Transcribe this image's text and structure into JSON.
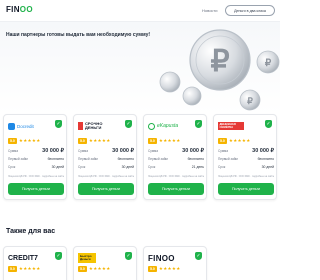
{
  "header": {
    "logo_main": "FIN",
    "logo_accent": "OO",
    "nav_news": "Новости",
    "cta_label": "Деньги в два клика"
  },
  "hero": {
    "title": "Наши партнеры готовы выдать вам необходимую сумму!"
  },
  "labels": {
    "amount": "Сумма",
    "first_loan": "Первый займ",
    "term": "Срок",
    "get_money": "Получить деньги",
    "fine_print": "Лицензия ЦБ РФ · ООО МКК · подробнее на сайте"
  },
  "offers": [
    {
      "name": "Docredit",
      "rating": "5.0",
      "amount": "30 000 ₽",
      "first_loan": "бесплатно",
      "term": "30 дней"
    },
    {
      "name": "СРОЧНО ДЕНЬГИ",
      "rating": "5.0",
      "amount": "30 000 ₽",
      "first_loan": "бесплатно",
      "term": "30 дней"
    },
    {
      "name": "eKapusta",
      "rating": "5.0",
      "amount": "30 000 ₽",
      "first_loan": "бесплатно",
      "term": "21 день"
    },
    {
      "name": "ДЕНЕЖНАЯ СЕМЁРКА",
      "rating": "5.0",
      "amount": "30 000 ₽",
      "first_loan": "бесплатно",
      "term": "30 дней"
    }
  ],
  "section2": {
    "title": "Также для вас"
  },
  "offers2": [
    {
      "name": "CREDIT7",
      "rating": "5.0"
    },
    {
      "name": "Быстро Деньги",
      "rating": "5.0"
    },
    {
      "name": "FINOO",
      "rating": "5.0"
    }
  ],
  "colors": {
    "brand_green": "#1fb24a",
    "rating_gold": "#f5b400",
    "shield_icon": "shield-check-icon"
  }
}
